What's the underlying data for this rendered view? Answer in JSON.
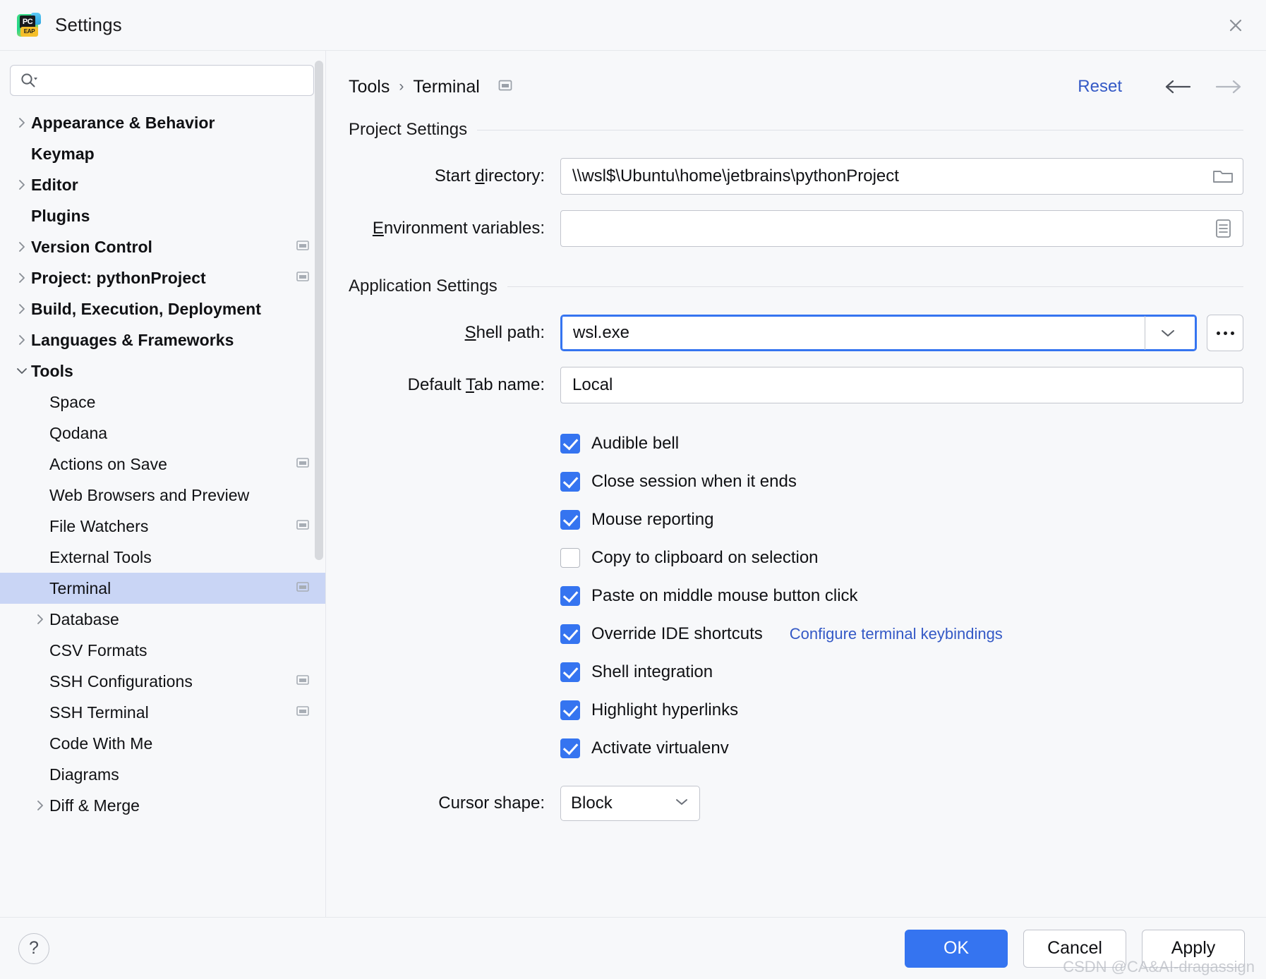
{
  "window": {
    "title": "Settings",
    "app_icon": "pycharm-eap-icon",
    "icon_text": "PC",
    "icon_badge": "EAP",
    "close_icon": "close-icon"
  },
  "search": {
    "placeholder": "",
    "value": "",
    "icon": "search-icon"
  },
  "sidebar": {
    "items": [
      {
        "label": "Appearance & Behavior",
        "indent": 0,
        "group": true,
        "twisty": "chevron-right",
        "badge": false,
        "selected": false
      },
      {
        "label": "Keymap",
        "indent": 0,
        "group": true,
        "twisty": "none",
        "badge": false,
        "selected": false
      },
      {
        "label": "Editor",
        "indent": 0,
        "group": true,
        "twisty": "chevron-right",
        "badge": false,
        "selected": false
      },
      {
        "label": "Plugins",
        "indent": 0,
        "group": true,
        "twisty": "none",
        "badge": false,
        "selected": false
      },
      {
        "label": "Version Control",
        "indent": 0,
        "group": true,
        "twisty": "chevron-right",
        "badge": true,
        "selected": false
      },
      {
        "label": "Project: pythonProject",
        "indent": 0,
        "group": true,
        "twisty": "chevron-right",
        "badge": true,
        "selected": false
      },
      {
        "label": "Build, Execution, Deployment",
        "indent": 0,
        "group": true,
        "twisty": "chevron-right",
        "badge": false,
        "selected": false
      },
      {
        "label": "Languages & Frameworks",
        "indent": 0,
        "group": true,
        "twisty": "chevron-right",
        "badge": false,
        "selected": false
      },
      {
        "label": "Tools",
        "indent": 0,
        "group": true,
        "twisty": "chevron-down",
        "badge": false,
        "selected": false
      },
      {
        "label": "Space",
        "indent": 1,
        "group": false,
        "twisty": "none",
        "badge": false,
        "selected": false
      },
      {
        "label": "Qodana",
        "indent": 1,
        "group": false,
        "twisty": "none",
        "badge": false,
        "selected": false
      },
      {
        "label": "Actions on Save",
        "indent": 1,
        "group": false,
        "twisty": "none",
        "badge": true,
        "selected": false
      },
      {
        "label": "Web Browsers and Preview",
        "indent": 1,
        "group": false,
        "twisty": "none",
        "badge": false,
        "selected": false
      },
      {
        "label": "File Watchers",
        "indent": 1,
        "group": false,
        "twisty": "none",
        "badge": true,
        "selected": false
      },
      {
        "label": "External Tools",
        "indent": 1,
        "group": false,
        "twisty": "none",
        "badge": false,
        "selected": false
      },
      {
        "label": "Terminal",
        "indent": 1,
        "group": false,
        "twisty": "none",
        "badge": true,
        "selected": true
      },
      {
        "label": "Database",
        "indent": 1,
        "group": false,
        "twisty": "chevron-right",
        "badge": false,
        "selected": false
      },
      {
        "label": "CSV Formats",
        "indent": 1,
        "group": false,
        "twisty": "none",
        "badge": false,
        "selected": false
      },
      {
        "label": "SSH Configurations",
        "indent": 1,
        "group": false,
        "twisty": "none",
        "badge": true,
        "selected": false
      },
      {
        "label": "SSH Terminal",
        "indent": 1,
        "group": false,
        "twisty": "none",
        "badge": true,
        "selected": false
      },
      {
        "label": "Code With Me",
        "indent": 1,
        "group": false,
        "twisty": "none",
        "badge": false,
        "selected": false
      },
      {
        "label": "Diagrams",
        "indent": 1,
        "group": false,
        "twisty": "none",
        "badge": false,
        "selected": false
      },
      {
        "label": "Diff & Merge",
        "indent": 1,
        "group": false,
        "twisty": "chevron-right",
        "badge": false,
        "selected": false
      }
    ]
  },
  "header": {
    "breadcrumb": [
      "Tools",
      "Terminal"
    ],
    "separator": "›",
    "scope_badge_icon": "project-scope-icon",
    "reset_label": "Reset",
    "back_icon": "arrow-left-icon",
    "forward_icon": "arrow-right-icon"
  },
  "project_settings": {
    "title": "Project Settings",
    "start_directory": {
      "label_pre": "Start ",
      "label_mnemonic": "d",
      "label_post": "irectory:",
      "value": "\\\\wsl$\\Ubuntu\\home\\jetbrains\\pythonProject",
      "browse_icon": "folder-icon"
    },
    "environment_variables": {
      "label_pre": "",
      "label_mnemonic": "E",
      "label_post": "nvironment variables:",
      "value": "",
      "browse_icon": "list-editor-icon"
    }
  },
  "application_settings": {
    "title": "Application Settings",
    "shell_path": {
      "label_pre": "",
      "label_mnemonic": "S",
      "label_post": "hell path:",
      "value": "wsl.exe",
      "focused": true,
      "dropdown_icon": "chevron-down-icon",
      "more_button_label": "…",
      "more_button_icon": "ellipsis-icon"
    },
    "default_tab_name": {
      "label_pre": "Default ",
      "label_mnemonic": "T",
      "label_post": "ab name:",
      "value": "Local"
    },
    "checkboxes": [
      {
        "label": "Audible bell",
        "checked": true,
        "link": null
      },
      {
        "label": "Close session when it ends",
        "checked": true,
        "link": null
      },
      {
        "label": "Mouse reporting",
        "checked": true,
        "link": null
      },
      {
        "label": "Copy to clipboard on selection",
        "checked": false,
        "link": null
      },
      {
        "label": "Paste on middle mouse button click",
        "checked": true,
        "link": null
      },
      {
        "label": "Override IDE shortcuts",
        "checked": true,
        "link": "Configure terminal keybindings"
      },
      {
        "label": "Shell integration",
        "checked": true,
        "link": null
      },
      {
        "label": "Highlight hyperlinks",
        "checked": true,
        "link": null
      },
      {
        "label": "Activate virtualenv",
        "checked": true,
        "link": null
      }
    ],
    "cursor_shape": {
      "label": "Cursor shape:",
      "value": "Block",
      "dropdown_icon": "chevron-down-icon"
    }
  },
  "footer": {
    "help_label": "?",
    "help_icon": "help-icon",
    "ok_label": "OK",
    "cancel_label": "Cancel",
    "apply_label": "Apply"
  },
  "watermark": "CSDN @CA&AI-dragassign",
  "colors": {
    "accent": "#3574f0",
    "link": "#3459c6",
    "selection": "#c9d5f5",
    "background": "#f7f8fa",
    "field_border": "#c2c5cd"
  }
}
